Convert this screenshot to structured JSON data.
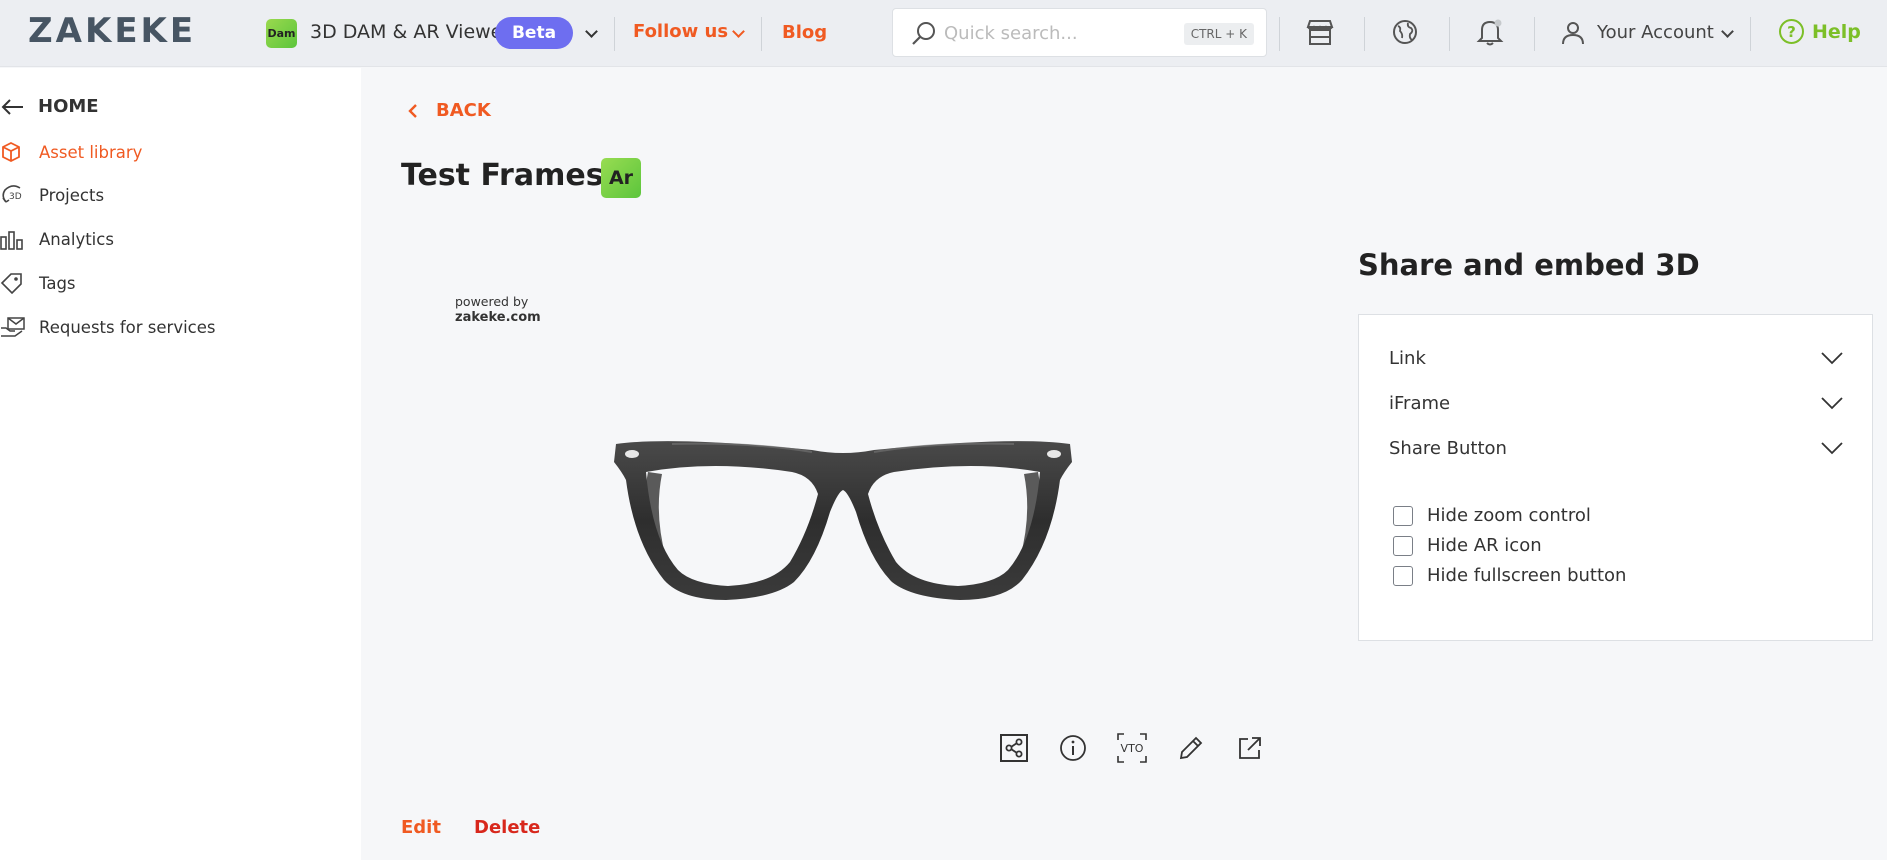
{
  "header": {
    "logo_text": "ZAKEKE",
    "product_badge": "Dam",
    "product_name": "3D DAM & AR Viewer",
    "beta_label": "Beta",
    "follow_label": "Follow us",
    "blog_label": "Blog",
    "search": {
      "placeholder": "Quick search...",
      "shortcut": "CTRL + K"
    },
    "account_label": "Your Account",
    "help_label": "Help",
    "icons": [
      "store-icon",
      "globe-icon",
      "bell-icon",
      "user-icon"
    ]
  },
  "sidebar": {
    "home_label": "HOME",
    "items": [
      {
        "label": "Asset library",
        "icon": "cube-icon",
        "active": true
      },
      {
        "label": "Projects",
        "icon": "3d-rotate-icon",
        "active": false
      },
      {
        "label": "Analytics",
        "icon": "bar-chart-icon",
        "active": false
      },
      {
        "label": "Tags",
        "icon": "tag-icon",
        "active": false
      },
      {
        "label": "Requests for services",
        "icon": "services-icon",
        "active": false
      }
    ]
  },
  "main": {
    "back_label": "BACK",
    "title": "Test Frames",
    "badge": "Ar",
    "powered_line1": "powered by",
    "powered_line2": "zakeke.com",
    "tools": [
      "share-icon",
      "info-icon",
      "vto-icon",
      "pencil-icon",
      "external-link-icon"
    ],
    "vto_label": "VTO",
    "edit_label": "Edit",
    "delete_label": "Delete"
  },
  "share": {
    "title": "Share and embed 3D",
    "sections": [
      "Link",
      "iFrame",
      "Share Button"
    ],
    "options": [
      {
        "label": "Hide zoom control",
        "checked": false
      },
      {
        "label": "Hide AR icon",
        "checked": false
      },
      {
        "label": "Hide fullscreen button",
        "checked": false
      }
    ]
  },
  "colors": {
    "accent": "#f05a22",
    "danger": "#d8271c",
    "help": "#7cbf28",
    "beta": "#6e6ef0"
  }
}
